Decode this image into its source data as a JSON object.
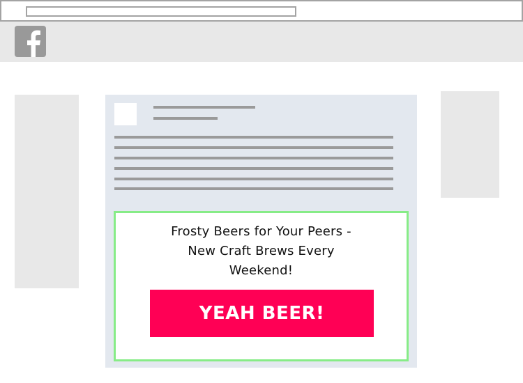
{
  "browser": {
    "address_bar_value": ""
  },
  "header": {
    "logo_icon": "facebook-icon",
    "logo_color": "#999999"
  },
  "ad": {
    "headline": "Frosty Beers for Your Peers - New Craft Brews Every Weekend!",
    "cta_label": "YEAH BEER!",
    "cta_color": "#ff0055",
    "border_color": "#87ec87"
  }
}
